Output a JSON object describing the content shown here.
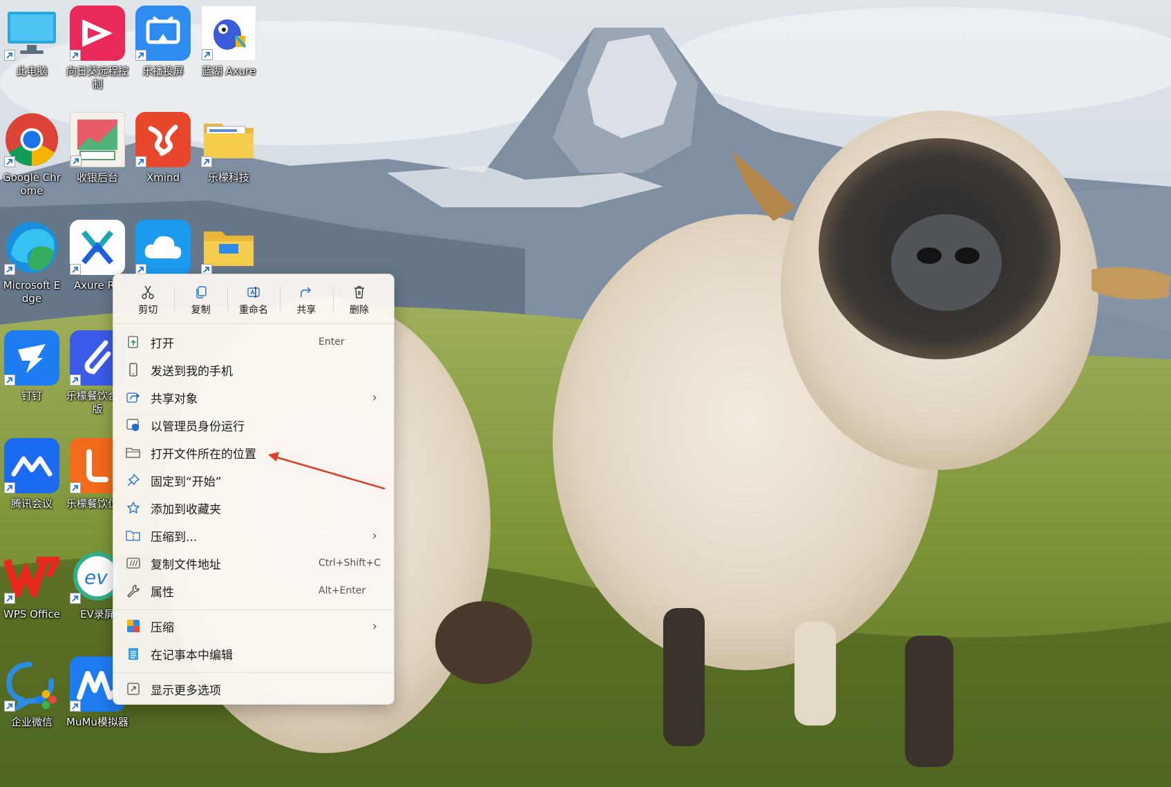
{
  "desktop": {
    "icons": [
      {
        "label": "此电脑",
        "icon": "this-pc-icon"
      },
      {
        "label": "向日葵远程控制",
        "icon": "sunlogin-icon"
      },
      {
        "label": "乐播投屏",
        "icon": "lebo-cast-icon"
      },
      {
        "label": "蓝湖 Axure",
        "icon": "lanhu-axure-icon"
      },
      {
        "label": "Google Chrome",
        "icon": "chrome-icon"
      },
      {
        "label": "收银后台",
        "icon": "pospal-icon"
      },
      {
        "label": "Xmind",
        "icon": "xmind-icon"
      },
      {
        "label": "乐檬科技",
        "icon": "folder-icon"
      },
      {
        "label": "Microsoft Edge",
        "icon": "edge-icon"
      },
      {
        "label": "Axure RP",
        "icon": "axure-icon"
      },
      {
        "label": "",
        "icon": "cloud-app-icon"
      },
      {
        "label": "",
        "icon": "folder-icon"
      },
      {
        "label": "钉钉",
        "icon": "dingtalk-icon"
      },
      {
        "label": "乐檬餐饮合位版",
        "icon": "lemeng-restaurant-icon"
      },
      {
        "label": "腾讯会议",
        "icon": "tencent-meeting-icon"
      },
      {
        "label": "乐檬餐饮位版",
        "icon": "lemeng-restaurant-2-icon"
      },
      {
        "label": "WPS Office",
        "icon": "wps-icon"
      },
      {
        "label": "EV录屏",
        "icon": "ev-recorder-icon"
      },
      {
        "label": "企业微信",
        "icon": "wecom-icon"
      },
      {
        "label": "MuMu模拟器",
        "icon": "mumu-icon"
      }
    ]
  },
  "context_menu": {
    "quick_actions": [
      {
        "label": "剪切",
        "icon": "scissors-icon"
      },
      {
        "label": "复制",
        "icon": "copy-icon"
      },
      {
        "label": "重命名",
        "icon": "rename-icon"
      },
      {
        "label": "共享",
        "icon": "share-icon"
      },
      {
        "label": "删除",
        "icon": "trash-icon"
      }
    ],
    "items": [
      {
        "label": "打开",
        "shortcut": "Enter",
        "icon": "open-icon"
      },
      {
        "label": "发送到我的手机",
        "icon": "phone-icon"
      },
      {
        "label": "共享对象",
        "submenu": "›",
        "icon": "share-icon"
      },
      {
        "label": "以管理员身份运行",
        "icon": "shield-icon"
      },
      {
        "label": "打开文件所在的位置",
        "icon": "folder-icon"
      },
      {
        "label": "固定到“开始”",
        "icon": "pin-icon"
      },
      {
        "label": "添加到收藏夹",
        "icon": "star-icon"
      },
      {
        "label": "压缩到...",
        "submenu": "›",
        "icon": "zip-folder-icon"
      },
      {
        "label": "复制文件地址",
        "shortcut": "Ctrl+Shift+C",
        "icon": "path-icon"
      },
      {
        "label": "属性",
        "shortcut": "Alt+Enter",
        "icon": "wrench-icon"
      },
      {
        "label": "压缩",
        "submenu": "›",
        "icon": "archive-icon"
      },
      {
        "label": "在记事本中编辑",
        "icon": "notepad-icon"
      },
      {
        "label": "显示更多选项",
        "icon": "more-options-icon"
      }
    ]
  },
  "colors": {
    "annotation_arrow": "#d9412b",
    "menu_background": "#faf6f0",
    "accent": "#1e6fd9"
  }
}
